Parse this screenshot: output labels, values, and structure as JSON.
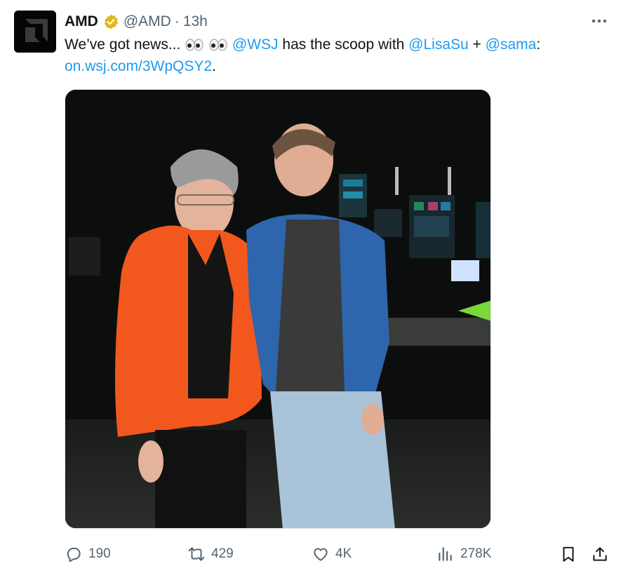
{
  "author": {
    "name": "AMD",
    "handle": "@AMD",
    "separator": "·",
    "time": "13h"
  },
  "tweet": {
    "text_intro": "We’ve got news...",
    "mention_wsj": "@WSJ",
    "text_mid": "has the scoop with",
    "mention_lisa": "@LisaSu",
    "plus": "+",
    "mention_sama": "@sama",
    "colon": ":",
    "link": "on.wsj.com/3WpQSY2",
    "period": "."
  },
  "metrics": {
    "replies": "190",
    "reposts": "429",
    "likes": "4K",
    "views": "278K"
  },
  "colors": {
    "link": "#1d9bf0",
    "muted": "#536471",
    "verified_badge": "#e2b719",
    "jacket": "#f2581d"
  },
  "icons": [
    "more-icon",
    "verified-badge-icon",
    "eyes-emoji-icon",
    "reply-icon",
    "repost-icon",
    "like-icon",
    "views-icon",
    "bookmark-icon",
    "share-icon"
  ]
}
